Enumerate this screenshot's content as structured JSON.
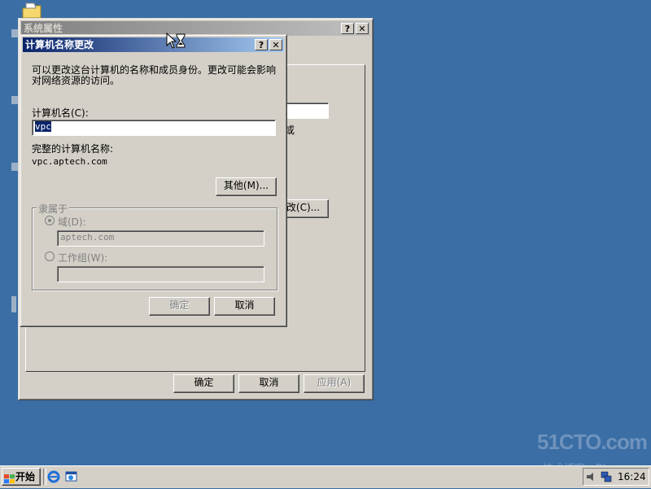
{
  "system_properties": {
    "title": "系统属性",
    "help_btn": "?",
    "close_btn": "✕",
    "partial_text_or": "或",
    "change_btn_partial": "改(C)...",
    "ok": "确定",
    "cancel": "取消",
    "apply": "应用(A)"
  },
  "dialog": {
    "title": "计算机名称更改",
    "help_btn": "?",
    "close_btn": "✕",
    "description_line1": "可以更改这台计算机的名称和成员身份。更改可能会影响",
    "description_line2": "对网络资源的访问。",
    "computer_name_label": "计算机名(C):",
    "computer_name_value": "vpc",
    "full_name_label": "完整的计算机名称:",
    "full_name_value": "vpc.aptech.com",
    "more_btn": "其他(M)...",
    "member_of_legend": "隶属于",
    "domain_label": "域(D):",
    "domain_value": "aptech.com",
    "workgroup_label": "工作组(W):",
    "workgroup_value": "",
    "ok": "确定",
    "cancel": "取消"
  },
  "taskbar": {
    "start_label": "开始",
    "clock": "16:24"
  },
  "watermark": {
    "line1": "51CTO.com",
    "line2": "技术博客—Blog—"
  },
  "colors": {
    "desktop": "#3a6ea5",
    "title_active": "#0a246a",
    "face": "#d4d0c8"
  }
}
